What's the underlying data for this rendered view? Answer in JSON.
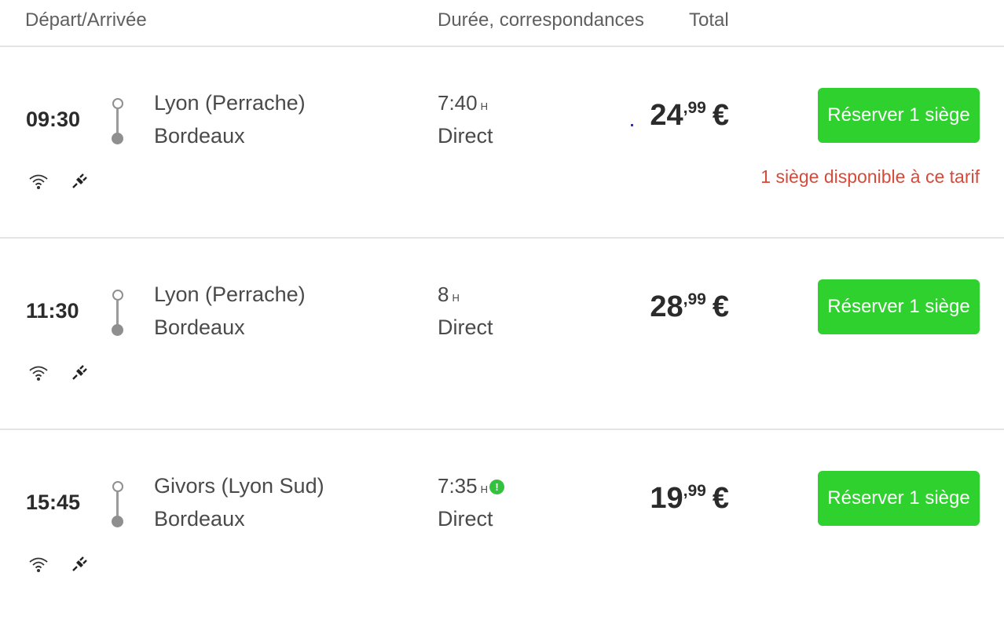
{
  "header": {
    "departure_arrival": "Départ/Arrivée",
    "duration": "Durée, correspondances",
    "total": "Total"
  },
  "trips": [
    {
      "time": "09:30",
      "from": "Lyon (Perrache)",
      "to": "Bordeaux",
      "duration": "7:40",
      "duration_unit": "H",
      "connections": "Direct",
      "price_int": "24",
      "price_cents": ",99",
      "currency": "€",
      "button": "Réserver 1 siège",
      "availability": "1 siège disponible à ce tarif",
      "amenities": [
        "wifi-icon",
        "power-plug-icon"
      ]
    },
    {
      "time": "11:30",
      "from": "Lyon (Perrache)",
      "to": "Bordeaux",
      "duration": "8",
      "duration_unit": "H",
      "connections": "Direct",
      "price_int": "28",
      "price_cents": ",99",
      "currency": "€",
      "button": "Réserver 1 siège",
      "amenities": [
        "wifi-icon",
        "power-plug-icon"
      ]
    },
    {
      "time": "15:45",
      "from": "Givors (Lyon Sud)",
      "to": "Bordeaux",
      "duration": "7:35",
      "duration_unit": "H",
      "info_badge": "!",
      "connections": "Direct",
      "price_int": "19",
      "price_cents": ",99",
      "currency": "€",
      "button": "Réserver 1 siège",
      "amenities": [
        "wifi-icon",
        "power-plug-icon"
      ]
    }
  ],
  "colors": {
    "button_green": "#2fd12f",
    "availability_red": "#d64a3a",
    "info_green": "#34c23e"
  }
}
